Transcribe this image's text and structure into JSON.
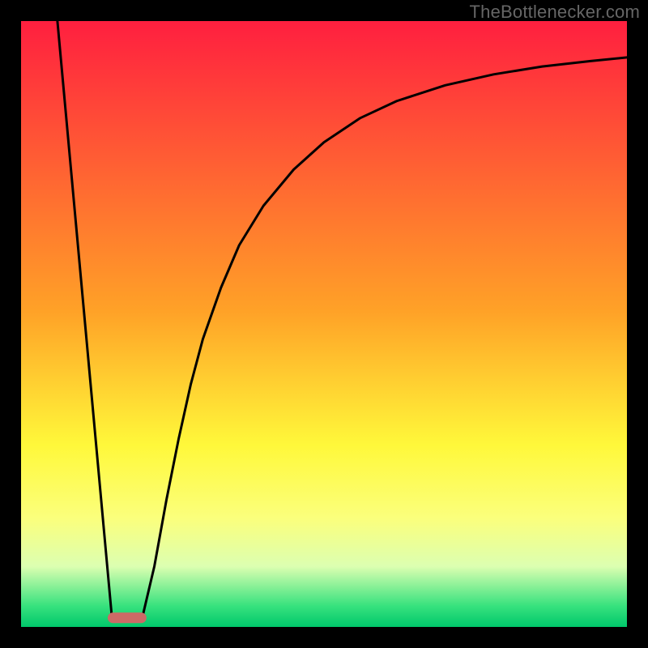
{
  "watermark": "TheBottlenecker.com",
  "chart_data": {
    "type": "line",
    "title": "",
    "xlabel": "",
    "ylabel": "",
    "xlim": [
      0,
      100
    ],
    "ylim": [
      0,
      100
    ],
    "gradient_stops": [
      {
        "offset": 0,
        "color": "#ff1f3f"
      },
      {
        "offset": 48,
        "color": "#ffa227"
      },
      {
        "offset": 70,
        "color": "#fff83a"
      },
      {
        "offset": 82,
        "color": "#fbff7c"
      },
      {
        "offset": 90,
        "color": "#dcffb1"
      },
      {
        "offset": 96.5,
        "color": "#38e27e"
      },
      {
        "offset": 100,
        "color": "#00c86b"
      }
    ],
    "marker": {
      "x_center": 17.5,
      "x_halfwidth": 3.2,
      "y": 98.5,
      "color": "#cc6a66"
    },
    "series": [
      {
        "name": "left-line",
        "stroke": "#000000",
        "points": [
          {
            "x": 6.0,
            "y": 0
          },
          {
            "x": 15.0,
            "y": 98.5
          }
        ]
      },
      {
        "name": "right-curve",
        "stroke": "#000000",
        "points": [
          {
            "x": 20.0,
            "y": 98.5
          },
          {
            "x": 22.0,
            "y": 90.0
          },
          {
            "x": 24.0,
            "y": 79.0
          },
          {
            "x": 26.0,
            "y": 69.0
          },
          {
            "x": 28.0,
            "y": 60.0
          },
          {
            "x": 30.0,
            "y": 52.5
          },
          {
            "x": 33.0,
            "y": 44.0
          },
          {
            "x": 36.0,
            "y": 37.0
          },
          {
            "x": 40.0,
            "y": 30.5
          },
          {
            "x": 45.0,
            "y": 24.5
          },
          {
            "x": 50.0,
            "y": 20.0
          },
          {
            "x": 56.0,
            "y": 16.0
          },
          {
            "x": 62.0,
            "y": 13.2
          },
          {
            "x": 70.0,
            "y": 10.6
          },
          {
            "x": 78.0,
            "y": 8.8
          },
          {
            "x": 86.0,
            "y": 7.5
          },
          {
            "x": 94.0,
            "y": 6.6
          },
          {
            "x": 100.0,
            "y": 6.0
          }
        ]
      }
    ]
  }
}
